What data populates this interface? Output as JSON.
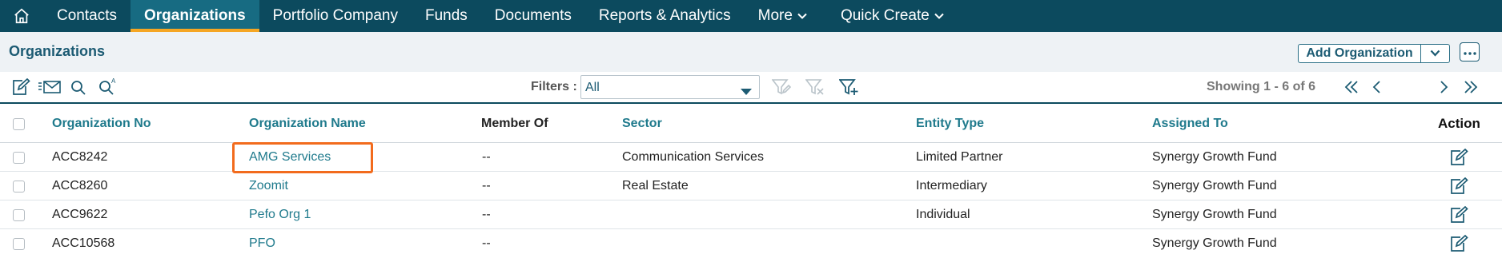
{
  "nav": {
    "items": [
      {
        "label": "Contacts"
      },
      {
        "label": "Organizations",
        "active": true
      },
      {
        "label": "Portfolio Company"
      },
      {
        "label": "Funds"
      },
      {
        "label": "Documents"
      },
      {
        "label": "Reports & Analytics"
      },
      {
        "label": "More",
        "has_dropdown": true
      },
      {
        "label": "Quick Create",
        "has_dropdown": true
      }
    ],
    "home_icon": "home-icon"
  },
  "header": {
    "title": "Organizations",
    "add_button": "Add Organization"
  },
  "toolbar": {
    "filters_label": "Filters :",
    "filter_value": "All",
    "showing": "Showing 1 - 6 of 6"
  },
  "table": {
    "columns": [
      "Organization No",
      "Organization Name",
      "Member Of",
      "Sector",
      "Entity Type",
      "Assigned To",
      "Action"
    ],
    "rows": [
      {
        "no": "ACC8242",
        "name": "AMG Services",
        "member": "--",
        "sector": "Communication Services",
        "entity": "Limited Partner",
        "assigned": "Synergy Growth Fund"
      },
      {
        "no": "ACC8260",
        "name": "Zoomit",
        "member": "--",
        "sector": "Real Estate",
        "entity": "Intermediary",
        "assigned": "Synergy Growth Fund"
      },
      {
        "no": "ACC9622",
        "name": "Pefo Org 1",
        "member": "--",
        "sector": "",
        "entity": "Individual",
        "assigned": "Synergy Growth Fund"
      },
      {
        "no": "ACC10568",
        "name": "PFO",
        "member": "--",
        "sector": "",
        "entity": "",
        "assigned": "Synergy Growth Fund"
      }
    ]
  },
  "colors": {
    "nav_bg": "#0c4a5e",
    "nav_active": "#176b82",
    "accent": "#f5a623",
    "link": "#1f7a8c",
    "highlight": "#f26b1d"
  }
}
